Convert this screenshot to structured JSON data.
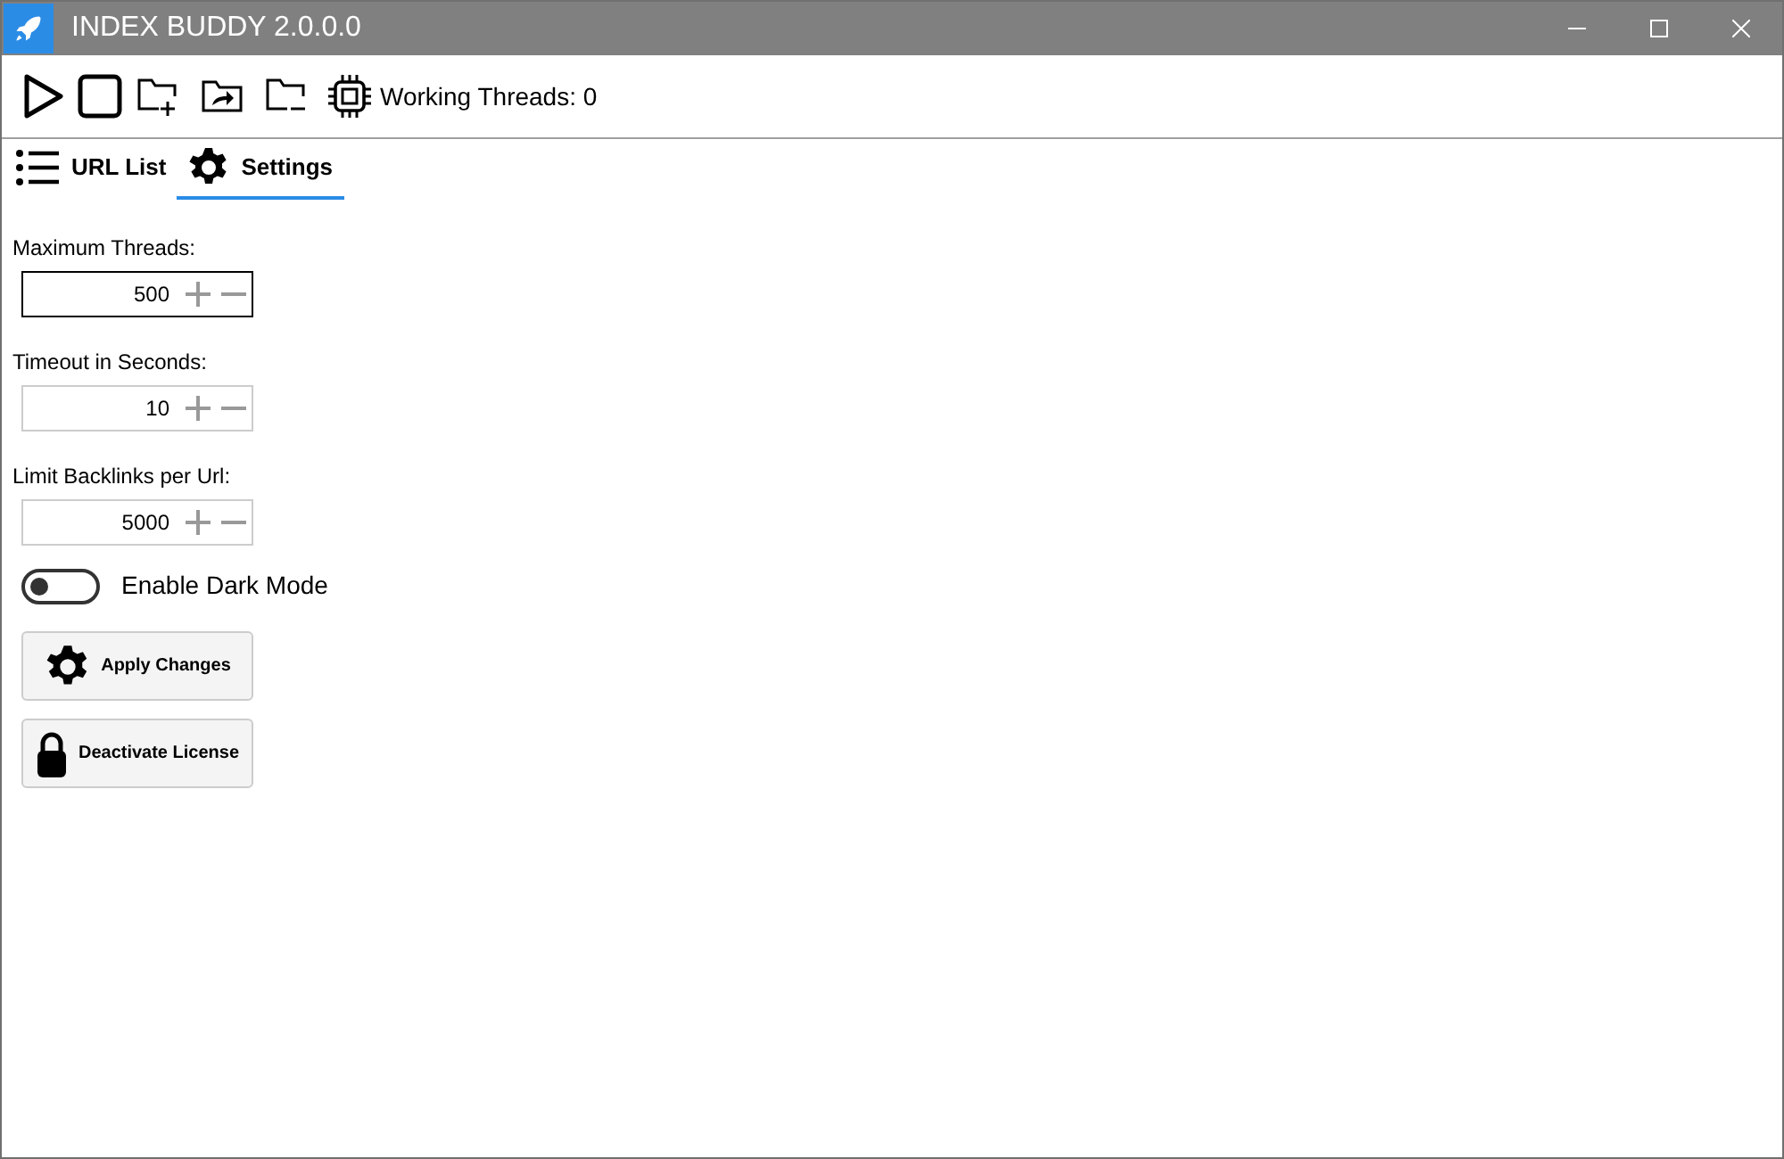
{
  "window": {
    "title": "INDEX BUDDY 2.0.0.0"
  },
  "toolbar": {
    "status": "Working Threads: 0"
  },
  "tabs": [
    {
      "label": "URL List",
      "selected": false
    },
    {
      "label": "Settings",
      "selected": true
    }
  ],
  "fields": [
    {
      "label": "Maximum Threads:",
      "value": "500",
      "focused": true
    },
    {
      "label": "Timeout in Seconds:",
      "value": "10",
      "focused": false
    },
    {
      "label": "Limit Backlinks per Url:",
      "value": "5000",
      "focused": false
    }
  ],
  "toggle": {
    "label": "Enable Dark Mode",
    "on": false
  },
  "buttons": [
    {
      "label": "Apply Changes",
      "kind": "gear"
    },
    {
      "label": "Deactivate License",
      "kind": "lock"
    }
  ]
}
